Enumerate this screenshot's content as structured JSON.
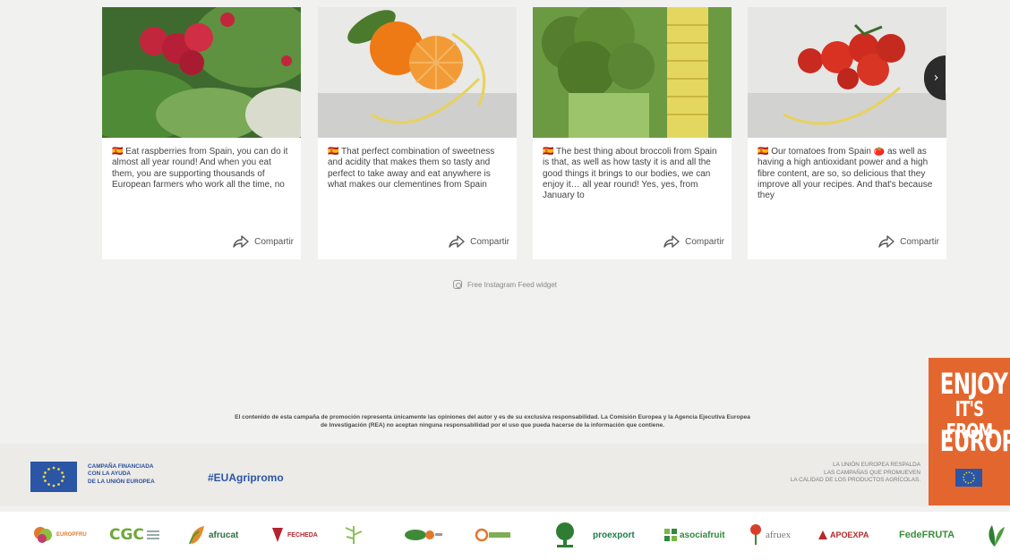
{
  "feed": {
    "cards": [
      {
        "caption": "🇪🇸 Eat raspberries from Spain, you can do it almost all year round! And when you eat them, you are supporting thousands of European farmers who work all the time, no",
        "share_label": "Compartir"
      },
      {
        "caption": "🇪🇸 That perfect combination of sweetness and acidity that makes them so tasty and perfect to take away and eat anywhere is what makes our clementines from Spain",
        "share_label": "Compartir"
      },
      {
        "caption": "🇪🇸 The best thing about broccoli from Spain is that, as well as how tasty it is and all the good things it brings to our bodies, we can enjoy it… all year round! Yes, yes, from January to",
        "share_label": "Compartir"
      },
      {
        "caption": "🇪🇸 Our tomatoes from Spain 🍅 as well as having a high antioxidant power and a high fibre content, are so, so delicious that they improve all your recipes. And that's because they",
        "share_label": "Compartir"
      }
    ],
    "next_icon": "›",
    "credit": "Free Instagram Feed widget"
  },
  "disclaimer": {
    "line1": "El contenido de esta campaña de promoción representa únicamente las opiniones del autor y es de su exclusiva responsabilidad. La Comisión Europea y la Agencia Ejecutiva Europea",
    "line2": "de Investigación (REA) no aceptan ninguna responsabilidad por el uso que pueda hacerse de la información que contiene."
  },
  "eu_band": {
    "funding_lines": [
      "CAMPAÑA FINANCIADA",
      "CON LA AYUDA",
      "DE LA UNIÓN EUROPEA"
    ],
    "hashtag": "#EUAgripromo",
    "support_lines": [
      "LA UNIÓN EUROPEA RESPALDA",
      "LAS CAMPAÑAS QUE PROMUEVEN",
      "LA CALIDAD DE LOS PRODUCTOS AGRÍCOLAS."
    ]
  },
  "enjoy": {
    "line1": "ENJOY",
    "line2": "IT'S FROM",
    "line3": "EUROPE"
  },
  "partners": [
    {
      "name": "EUROPFRU",
      "color": "#e2782c"
    },
    {
      "name": "CGC",
      "color": "#6fa83a"
    },
    {
      "name": "afrucat",
      "color": "#2d6e3e"
    },
    {
      "name": "FECHEDA",
      "color": "#b32430"
    },
    {
      "name": "Apoexpa",
      "color": "#7fae55"
    },
    {
      "name": "proexport",
      "color": "#1a7f4b"
    },
    {
      "name": "asociafruit",
      "color": "#2f8a3c"
    },
    {
      "name": "afruex",
      "color": "#7a7a7a"
    },
    {
      "name": "APOEXPA",
      "color": "#b52a2a"
    },
    {
      "name": "FedeFRUTA",
      "color": "#3a8e3a"
    }
  ],
  "colors": {
    "background": "#f1f1f0",
    "eu_blue": "#2b55a5",
    "enjoy_orange": "#e4662f"
  }
}
